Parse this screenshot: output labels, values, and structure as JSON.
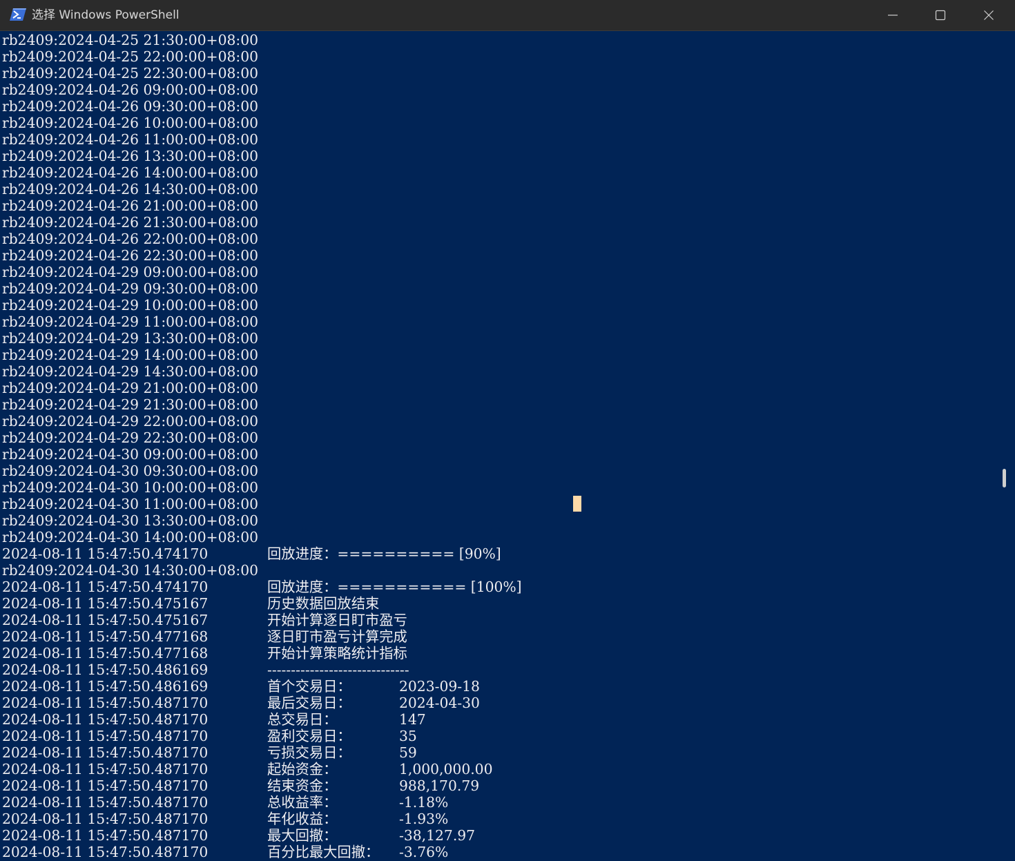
{
  "window": {
    "title": "选择 Windows PowerShell",
    "icon": "powershell-icon",
    "accent_bg": "#012456",
    "text_color": "#eeedf0",
    "cursor_color": "#fdd9a8",
    "controls": {
      "minimize": "minimize-icon",
      "maximize": "maximize-icon",
      "close": "close-icon"
    }
  },
  "console": {
    "bar_lines": [
      "rb2409:2024-04-25 21:30:00+08:00",
      "rb2409:2024-04-25 22:00:00+08:00",
      "rb2409:2024-04-25 22:30:00+08:00",
      "rb2409:2024-04-26 09:00:00+08:00",
      "rb2409:2024-04-26 09:30:00+08:00",
      "rb2409:2024-04-26 10:00:00+08:00",
      "rb2409:2024-04-26 11:00:00+08:00",
      "rb2409:2024-04-26 13:30:00+08:00",
      "rb2409:2024-04-26 14:00:00+08:00",
      "rb2409:2024-04-26 14:30:00+08:00",
      "rb2409:2024-04-26 21:00:00+08:00",
      "rb2409:2024-04-26 21:30:00+08:00",
      "rb2409:2024-04-26 22:00:00+08:00",
      "rb2409:2024-04-26 22:30:00+08:00",
      "rb2409:2024-04-29 09:00:00+08:00",
      "rb2409:2024-04-29 09:30:00+08:00",
      "rb2409:2024-04-29 10:00:00+08:00",
      "rb2409:2024-04-29 11:00:00+08:00",
      "rb2409:2024-04-29 13:30:00+08:00",
      "rb2409:2024-04-29 14:00:00+08:00",
      "rb2409:2024-04-29 14:30:00+08:00",
      "rb2409:2024-04-29 21:00:00+08:00",
      "rb2409:2024-04-29 21:30:00+08:00",
      "rb2409:2024-04-29 22:00:00+08:00",
      "rb2409:2024-04-29 22:30:00+08:00",
      "rb2409:2024-04-30 09:00:00+08:00",
      "rb2409:2024-04-30 09:30:00+08:00",
      "rb2409:2024-04-30 10:00:00+08:00",
      "rb2409:2024-04-30 11:00:00+08:00",
      "rb2409:2024-04-30 13:30:00+08:00",
      "rb2409:2024-04-30 14:00:00+08:00"
    ],
    "progress_90": {
      "ts": "2024-08-11 15:47:50.474170",
      "msg": "回放进度：========== [90%]"
    },
    "bar_last": "rb2409:2024-04-30 14:30:00+08:00",
    "log_lines": [
      {
        "ts": "2024-08-11 15:47:50.474170",
        "msg": "回放进度：=========== [100%]"
      },
      {
        "ts": "2024-08-11 15:47:50.475167",
        "msg": "历史数据回放结束"
      },
      {
        "ts": "2024-08-11 15:47:50.475167",
        "msg": "开始计算逐日盯市盈亏"
      },
      {
        "ts": "2024-08-11 15:47:50.477168",
        "msg": "逐日盯市盈亏计算完成"
      },
      {
        "ts": "2024-08-11 15:47:50.477168",
        "msg": "开始计算策略统计指标"
      },
      {
        "ts": "2024-08-11 15:47:50.486169",
        "msg": "------------------------------"
      }
    ],
    "stats": [
      {
        "ts": "2024-08-11 15:47:50.486169",
        "label": "首个交易日：",
        "value": "2023-09-18"
      },
      {
        "ts": "2024-08-11 15:47:50.487170",
        "label": "最后交易日：",
        "value": "2024-04-30"
      },
      {
        "ts": "2024-08-11 15:47:50.487170",
        "label": "总交易日：",
        "value": "147"
      },
      {
        "ts": "2024-08-11 15:47:50.487170",
        "label": "盈利交易日：",
        "value": "35"
      },
      {
        "ts": "2024-08-11 15:47:50.487170",
        "label": "亏损交易日：",
        "value": "59"
      },
      {
        "ts": "2024-08-11 15:47:50.487170",
        "label": "起始资金：",
        "value": "1,000,000.00"
      },
      {
        "ts": "2024-08-11 15:47:50.487170",
        "label": "结束资金：",
        "value": "988,170.79"
      },
      {
        "ts": "2024-08-11 15:47:50.487170",
        "label": "总收益率：",
        "value": "-1.18%"
      },
      {
        "ts": "2024-08-11 15:47:50.487170",
        "label": "年化收益：",
        "value": "-1.93%"
      },
      {
        "ts": "2024-08-11 15:47:50.487170",
        "label": "最大回撤：",
        "value": "-38,127.97"
      },
      {
        "ts": "2024-08-11 15:47:50.487170",
        "label": "百分比最大回撤：",
        "value": "-3.76%"
      }
    ]
  }
}
